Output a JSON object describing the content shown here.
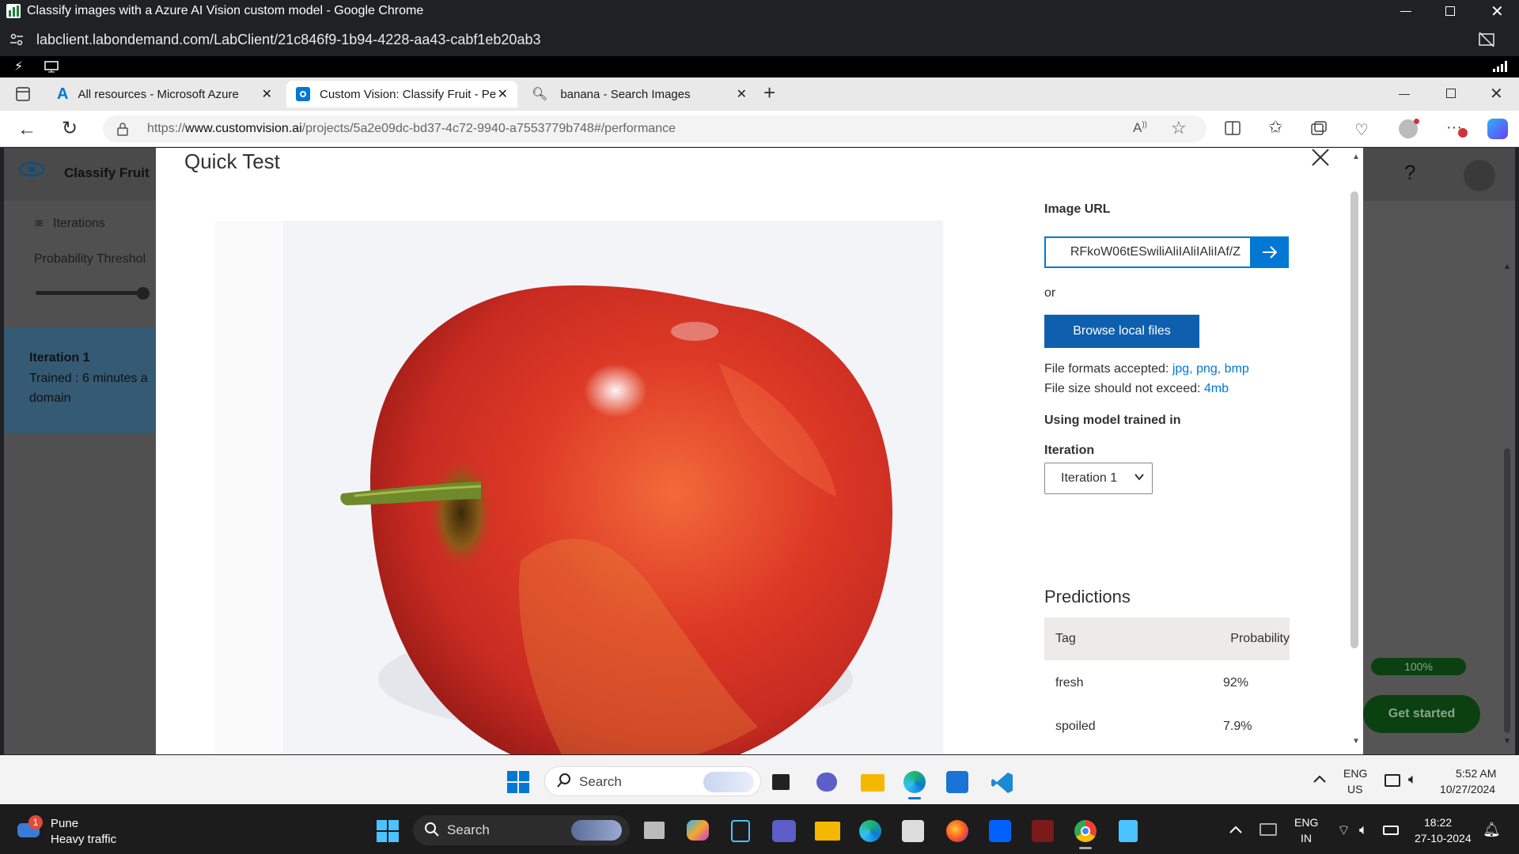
{
  "chrome": {
    "window_title": "Classify images with a Azure AI Vision custom model - Google Chrome",
    "url": "labclient.labondemand.com/LabClient/21c846f9-1b94-4228-aa43-cabf1eb20ab3"
  },
  "edge": {
    "tabs": [
      {
        "label": "All resources - Microsoft Azure",
        "icon": "azure-icon"
      },
      {
        "label": "Custom Vision: Classify Fruit - Pe",
        "icon": "custom-vision-icon"
      },
      {
        "label": "banana - Search Images",
        "icon": "search-icon"
      }
    ],
    "url_prefix": "https://",
    "url_domain": "www.customvision.ai",
    "url_path": "/projects/5a2e09dc-bd37-4c72-9940-a7553779b748#/performance"
  },
  "customvision": {
    "project_name": "Classify Fruit",
    "iterations_label": "Iterations",
    "probability_threshold_label": "Probability Threshol",
    "iteration_title": "Iteration 1",
    "trained_text": "Trained : 6 minutes a",
    "domain_text": "domain",
    "progress_label": "100%",
    "get_started": "Get started",
    "help": "?"
  },
  "quick_test": {
    "title": "Quick Test",
    "image_url_label": "Image URL",
    "image_url_value": "RFkoW06tESwiliAliIAliIAliIAf/Z",
    "or_text": "or",
    "browse_button": "Browse local files",
    "file_formats_prefix": "File formats accepted: ",
    "file_formats": "jpg, png, bmp",
    "file_size_prefix": "File size should not exceed: ",
    "file_size": "4mb",
    "using_model_label": "Using model trained in",
    "iteration_label": "Iteration",
    "iteration_selected": "Iteration 1",
    "predictions_title": "Predictions",
    "table_headers": {
      "tag": "Tag",
      "probability": "Probability"
    },
    "predictions": [
      {
        "tag": "fresh",
        "probability": "92%"
      },
      {
        "tag": "spoiled",
        "probability": "7.9%"
      }
    ]
  },
  "inner_taskbar": {
    "search": "Search",
    "lang_top": "ENG",
    "lang_bottom": "US",
    "time": "5:52 AM",
    "date": "10/27/2024"
  },
  "outer_taskbar": {
    "weather_city": "Pune",
    "weather_status": "Heavy traffic",
    "weather_badge": "1",
    "search": "Search",
    "lang_top": "ENG",
    "lang_bottom": "IN",
    "time": "18:22",
    "date": "27-10-2024"
  },
  "colors": {
    "accent": "#0078d4",
    "modal_bg": "#ffffff",
    "apple_red": "#d9322a",
    "progress_green": "#107c10"
  }
}
